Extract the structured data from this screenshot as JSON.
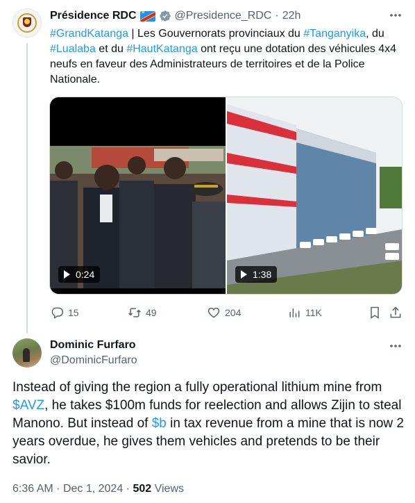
{
  "parent_tweet": {
    "author_name": "Présidence RDC",
    "handle": "@Presidence_RDC",
    "separator": "·",
    "time": "22h",
    "text": {
      "t1": "#GrandKatanga",
      "t2": " | Les Gouvernorats provinciaux du ",
      "t3": "#Tanganyika",
      "t4": ", du ",
      "t5": "#Lualaba",
      "t6": " et du ",
      "t7": "#HautKatanga",
      "t8": " ont reçu une dotation des véhicules 4x4 neufs en faveur des Administrateurs de territoires et de la Police Nationale."
    },
    "videos": [
      {
        "duration": "0:24",
        "icon": "play-icon"
      },
      {
        "duration": "1:38",
        "icon": "play-icon"
      }
    ],
    "stats": {
      "replies": "15",
      "reposts": "49",
      "likes": "204",
      "views": "11K"
    }
  },
  "reply_tweet": {
    "author_name": "Dominic Furfaro",
    "handle": "@DominicFurfaro",
    "text": {
      "r1": "Instead of giving the region a fully operational lithium mine from ",
      "r2": "$AVZ",
      "r3": ", he takes $100m funds for reelection and allows Zijin to steal Manono. But instead of ",
      "r4": "$b",
      "r5": " in tax revenue from a mine that is now 2 years overdue, he gives them vehicles and pretends to be their savior."
    },
    "meta": {
      "time": "6:36 AM",
      "date": "Dec 1, 2024",
      "separator": "·",
      "views_count": "502",
      "views_label": "Views"
    }
  },
  "colors": {
    "link": "#1d9bf0",
    "text_primary": "#0f1419",
    "text_secondary": "#536471",
    "verified": "#829aab",
    "divider": "#cfd9de"
  }
}
